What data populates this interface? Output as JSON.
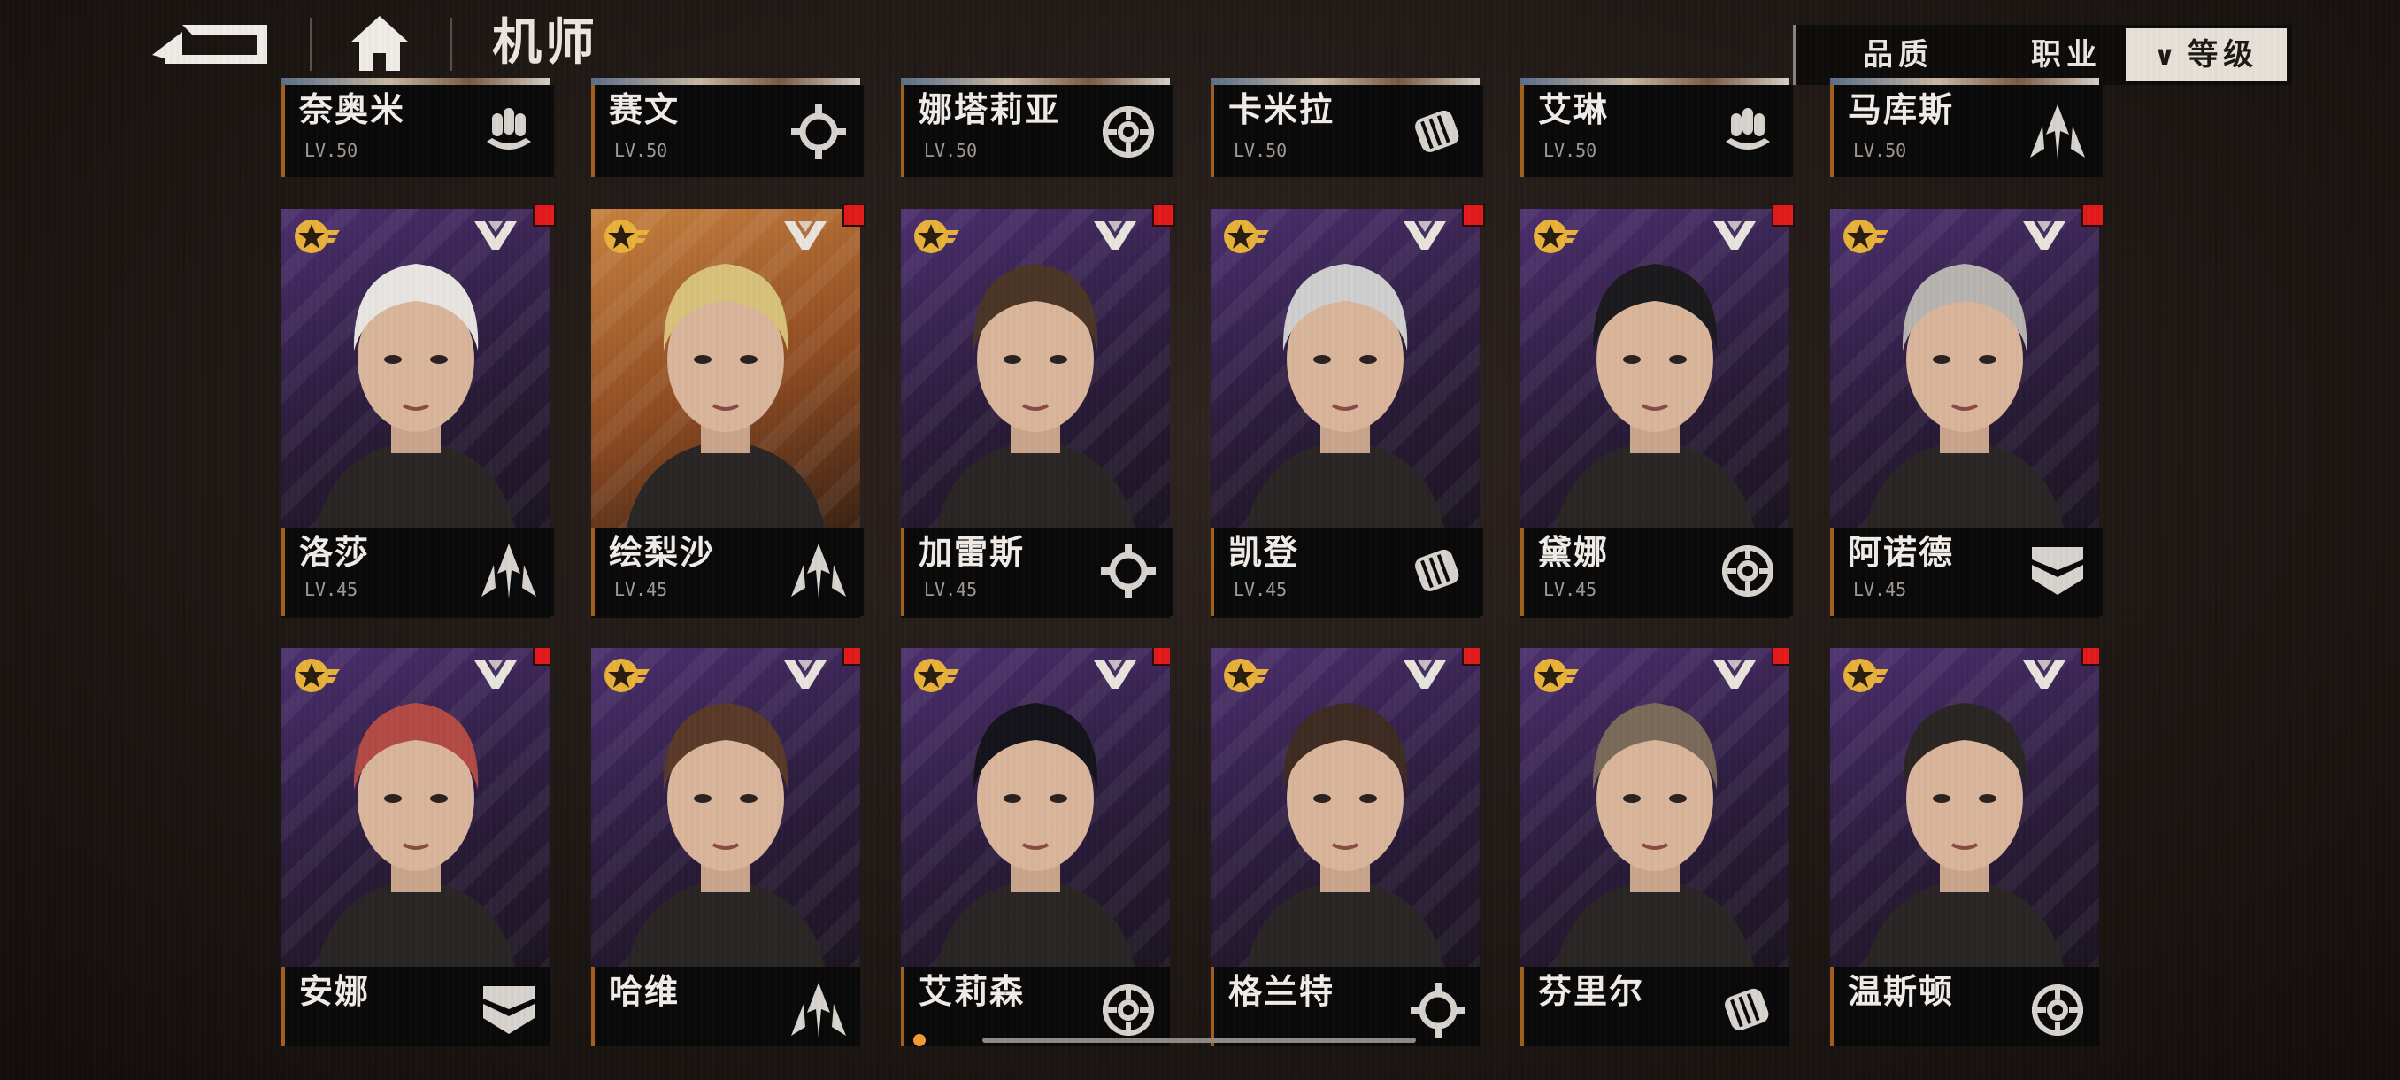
{
  "header": {
    "title": "机师",
    "filters": {
      "quality": "品质",
      "job": "职业",
      "level": "等级"
    }
  },
  "colors": {
    "accent_orange": "#a4611f",
    "badge_gold": "#e9b23a",
    "new_dot": "#e21b1b",
    "card_purple": "#3a2555",
    "card_orange": "#c8813f"
  },
  "rows": {
    "top": [
      {
        "name": "奈奥米",
        "level": "LV.50",
        "job_icon": "rocket-cluster-icon"
      },
      {
        "name": "赛文",
        "level": "LV.50",
        "job_icon": "wrench-gear-icon"
      },
      {
        "name": "娜塔莉亚",
        "level": "LV.50",
        "job_icon": "crosshair-icon"
      },
      {
        "name": "卡米拉",
        "level": "LV.50",
        "job_icon": "fist-icon"
      },
      {
        "name": "艾琳",
        "level": "LV.50",
        "job_icon": "rocket-cluster-icon"
      },
      {
        "name": "马库斯",
        "level": "LV.50",
        "job_icon": "arrow-blade-icon"
      }
    ],
    "middle": [
      {
        "name": "洛莎",
        "level": "LV.45",
        "job_icon": "arrow-blade-icon"
      },
      {
        "name": "绘梨沙",
        "level": "LV.45",
        "job_icon": "arrow-blade-icon"
      },
      {
        "name": "加雷斯",
        "level": "LV.45",
        "job_icon": "wrench-gear-icon"
      },
      {
        "name": "凯登",
        "level": "LV.45",
        "job_icon": "fist-icon"
      },
      {
        "name": "黛娜",
        "level": "LV.45",
        "job_icon": "crosshair-icon"
      },
      {
        "name": "阿诺德",
        "level": "LV.45",
        "job_icon": "shield-chevron-icon"
      }
    ],
    "bottom": [
      {
        "name": "安娜",
        "job_icon": "shield-chevron-icon"
      },
      {
        "name": "哈维",
        "job_icon": "arrow-blade-icon"
      },
      {
        "name": "艾莉森",
        "job_icon": "crosshair-icon"
      },
      {
        "name": "格兰特",
        "job_icon": "wrench-gear-icon"
      },
      {
        "name": "芬里尔",
        "job_icon": "fist-icon"
      },
      {
        "name": "温斯顿",
        "job_icon": "crosshair-icon"
      }
    ]
  }
}
